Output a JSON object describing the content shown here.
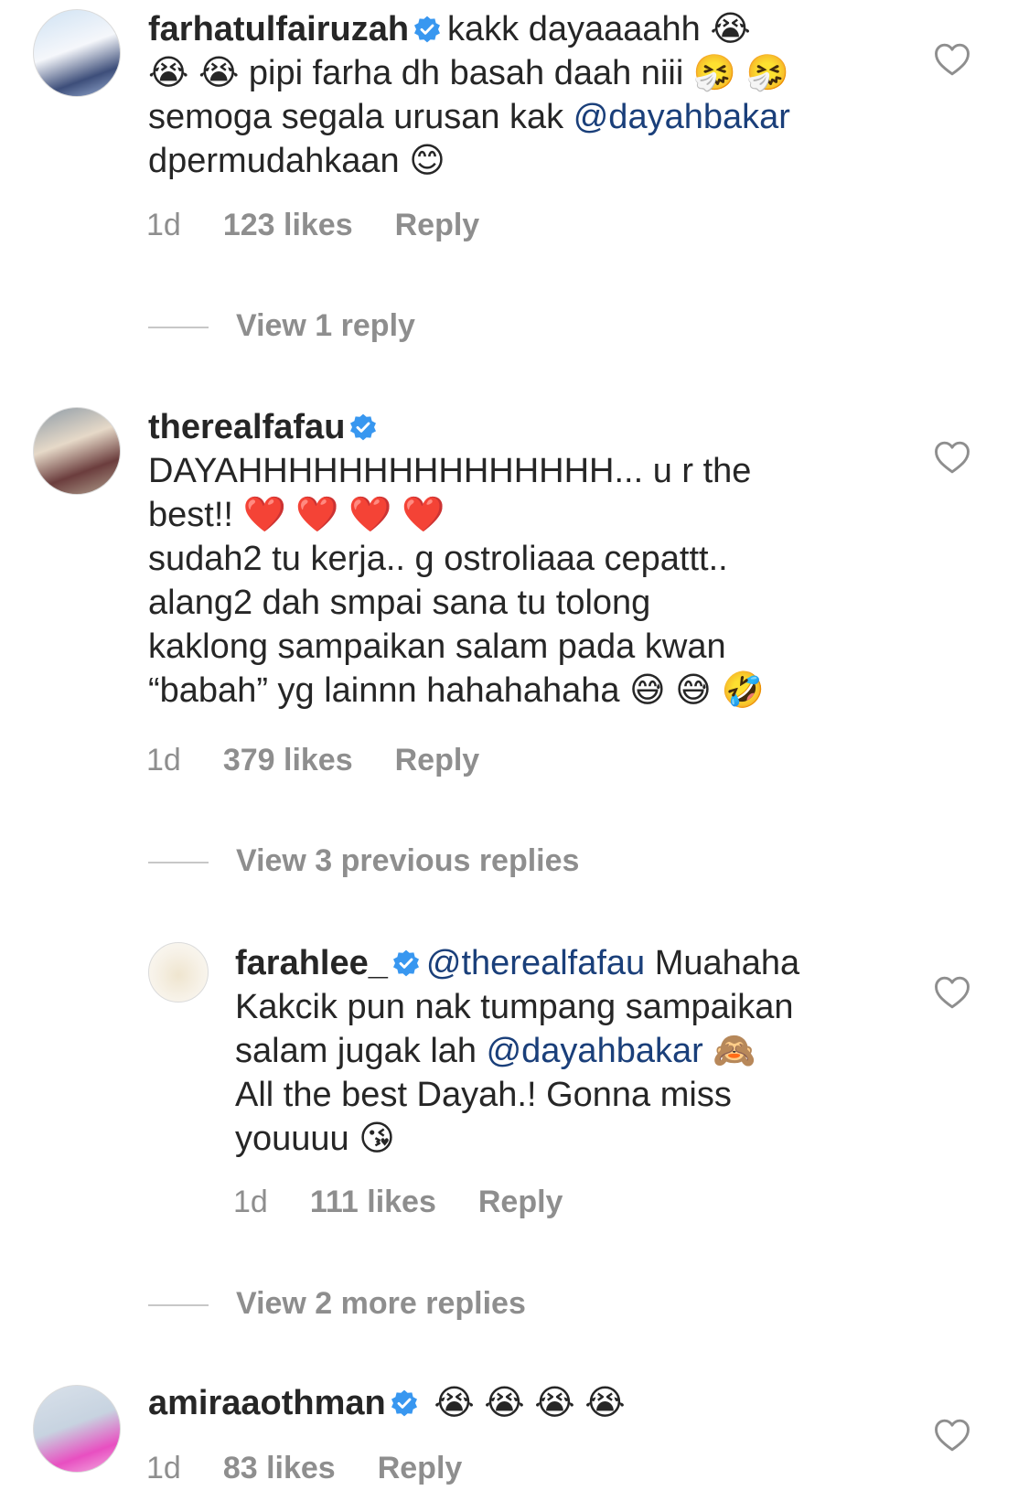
{
  "comments": [
    {
      "username": "farhatulfairuzah",
      "lines": [
        "kakk dayaaaahh 😭",
        "😭 😭  pipi farha dh basah daah niii 🤧 🤧",
        "semoga segala urusan kak ",
        "dpermudahkaan 😊"
      ],
      "mention": "@dayahbakar",
      "time": "1d",
      "likes": "123 likes",
      "reply": "Reply",
      "view_replies": "View 1 reply"
    },
    {
      "username": "therealfafau",
      "lines": [
        "DAYAHHHHHHHHHHHHHHH... u r the",
        "best!! ❤️ ❤️ ❤️ ❤️",
        "sudah2 tu kerja.. g ostroliaaa cepattt..",
        "alang2 dah smpai sana  tu tolong",
        "kaklong sampaikan salam pada kwan",
        "“babah” yg lainnn hahahahaha 😅 😅 🤣"
      ],
      "time": "1d",
      "likes": "379 likes",
      "reply": "Reply",
      "view_replies": "View 3 previous replies"
    },
    {
      "username": "farahlee_",
      "mention_start": "@therealfafau",
      "lines": [
        " Muahaha",
        "Kakcik pun nak tumpang sampaikan",
        "salam jugak lah ",
        " 🙈",
        "All the best Dayah.! Gonna miss",
        "youuuu 😘"
      ],
      "mention": "@dayahbakar",
      "time": "1d",
      "likes": "111 likes",
      "reply": "Reply",
      "view_replies": "View 2 more replies"
    },
    {
      "username": "amiraaothman",
      "lines": [
        "😭 😭 😭 😭"
      ],
      "time": "1d",
      "likes": "83 likes",
      "reply": "Reply"
    }
  ],
  "icons": {
    "verified": "verified-badge-icon",
    "like": "heart-icon"
  },
  "colors": {
    "verified": "#3897f0",
    "mention": "#1a3f7a",
    "meta": "#8e8e8e"
  }
}
